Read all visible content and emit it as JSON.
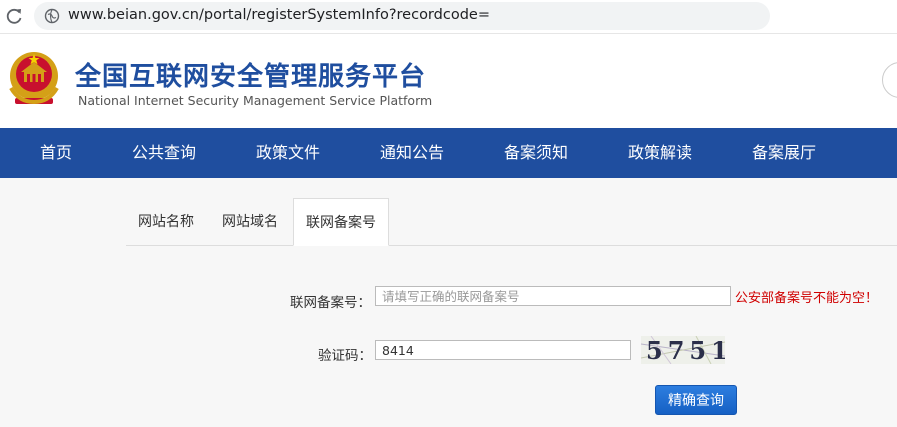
{
  "browser": {
    "url": "www.beian.gov.cn/portal/registerSystemInfo?recordcode="
  },
  "header": {
    "title_zh": "全国互联网安全管理服务平台",
    "title_en": "National Internet Security Management Service Platform"
  },
  "nav": {
    "items": [
      "首页",
      "公共查询",
      "政策文件",
      "通知公告",
      "备案须知",
      "政策解读",
      "备案展厅"
    ]
  },
  "tabs": {
    "items": [
      "网站名称",
      "网站域名",
      "联网备案号"
    ],
    "active": "联网备案号"
  },
  "form": {
    "record_label": "联网备案号：",
    "record_placeholder": "请填写正确的联网备案号",
    "record_value": "",
    "record_error": "公安部备案号不能为空！",
    "captcha_label": "验证码：",
    "captcha_value": "8414",
    "captcha_image_text": "5751",
    "submit_label": "精确查询"
  },
  "colors": {
    "brand_blue": "#1f4e9f",
    "error_red": "#d00000",
    "button_blue": "#1a6ad4"
  }
}
